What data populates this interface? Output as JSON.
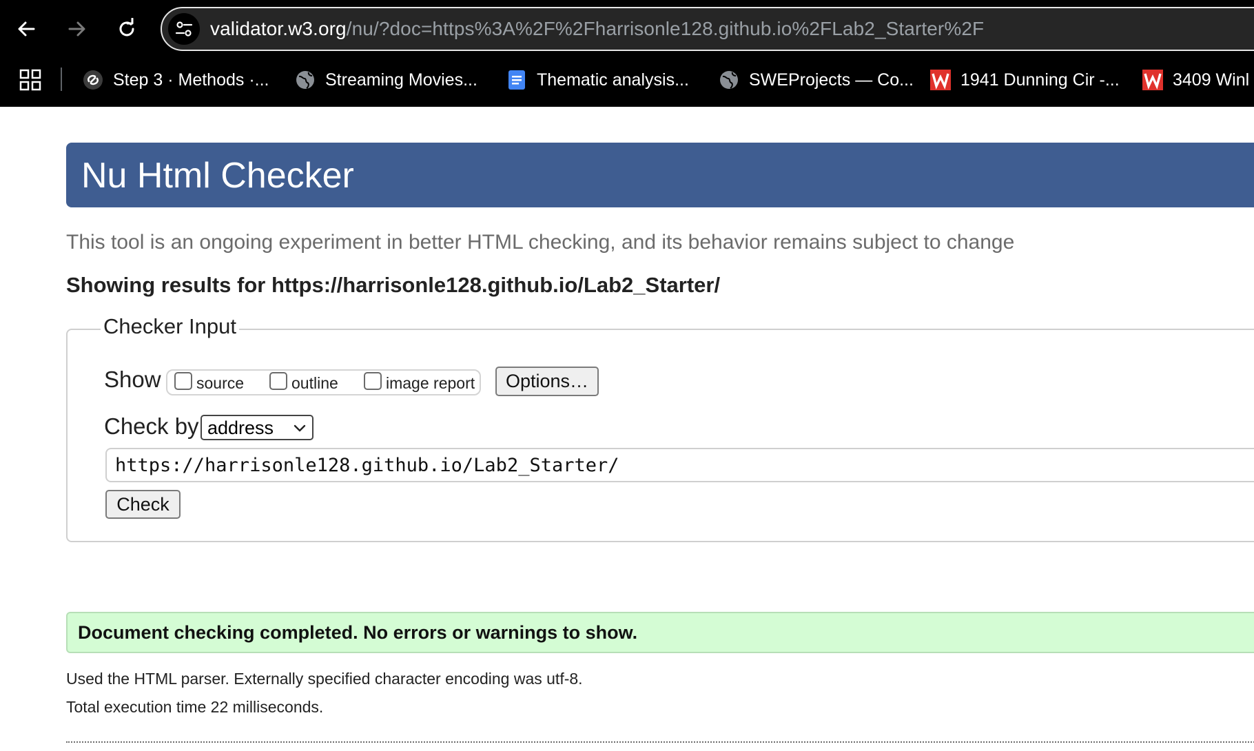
{
  "browser": {
    "url": {
      "host": "validator.w3.org",
      "path": "/nu/?doc=https%3A%2F%2Fharrisonle128.github.io%2FLab2_Starter%2F"
    },
    "bookmarks": [
      {
        "label": "Step 3 · Methods ·...",
        "icon": "link-swirl-icon"
      },
      {
        "label": "Streaming Movies...",
        "icon": "globe-icon"
      },
      {
        "label": "Thematic analysis...",
        "icon": "google-docs-icon"
      },
      {
        "label": "SWEProjects — Co...",
        "icon": "globe-icon"
      },
      {
        "label": "1941 Dunning Cir -...",
        "icon": "w-logo-icon"
      },
      {
        "label": "3409 Winl",
        "icon": "w-logo-icon"
      }
    ]
  },
  "page": {
    "title": "Nu Html Checker",
    "intro": "This tool is an ongoing experiment in better HTML checking, and its behavior remains subject to change",
    "results_for": "Showing results for https://harrisonle128.github.io/Lab2_Starter/",
    "checker_input": {
      "legend": "Checker Input",
      "show_label": "Show",
      "checkboxes": [
        {
          "label": "source",
          "checked": false
        },
        {
          "label": "outline",
          "checked": false
        },
        {
          "label": "image report",
          "checked": false
        }
      ],
      "options_button": "Options…",
      "check_by_label": "Check by",
      "check_by_value": "address",
      "url_value": "https://harrisonle128.github.io/Lab2_Starter/",
      "check_button": "Check"
    },
    "result": {
      "message": "Document checking completed. No errors or warnings to show.",
      "parser_note": "Used the HTML parser. Externally specified character encoding was utf-8.",
      "execution_time": "Total execution time 22 milliseconds."
    }
  },
  "colors": {
    "banner": "#3f5d91",
    "success_bg": "#d4fcd4",
    "chrome_bg": "#000000",
    "w_logo": "#e0322c",
    "docs_blue": "#4285f4"
  }
}
